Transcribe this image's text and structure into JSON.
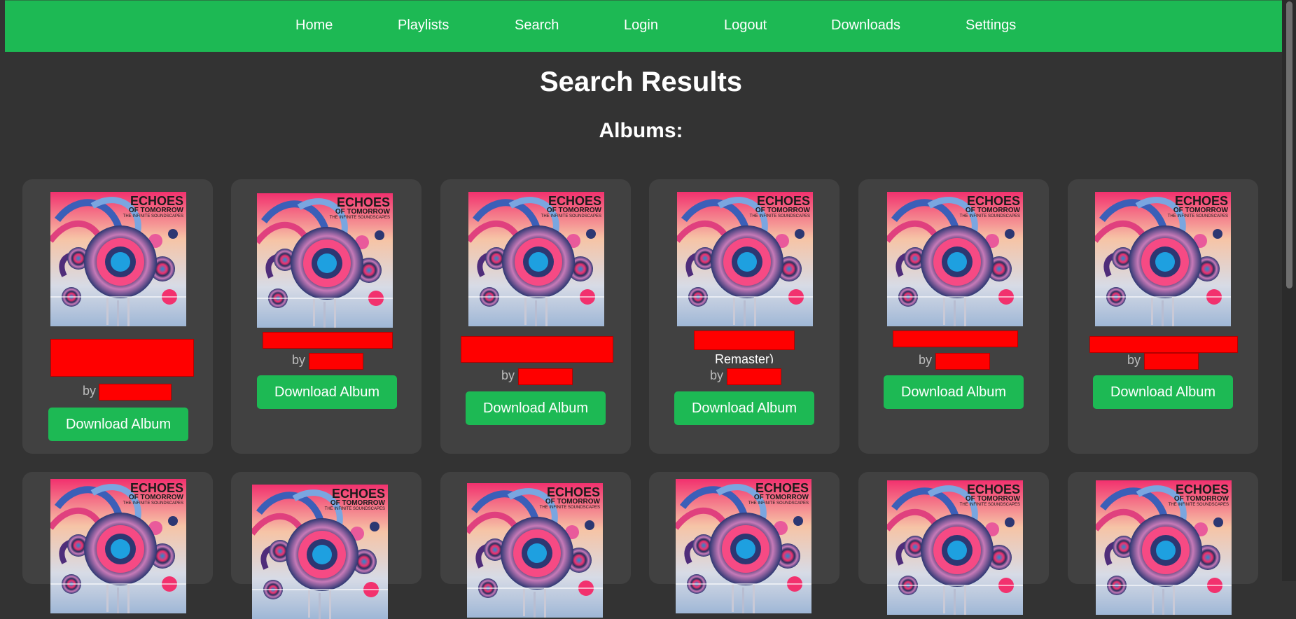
{
  "nav": {
    "home": "Home",
    "playlists": "Playlists",
    "search": "Search",
    "login": "Login",
    "logout": "Logout",
    "downloads": "Downloads",
    "settings": "Settings"
  },
  "page": {
    "title": "Search Results",
    "section": "Albums:"
  },
  "cover": {
    "title_line1": "ECHOES",
    "title_line2": "OF TOMORROW",
    "subtitle": "THE INFINITE SOUNDSCAPES"
  },
  "albums": [
    {
      "by": "by",
      "button": "Download Album"
    },
    {
      "by": "by",
      "button": "Download Album"
    },
    {
      "by": "by",
      "button": "Download Album"
    },
    {
      "title_tail": "Remaster)",
      "by": "by",
      "button": "Download Album"
    },
    {
      "by": "by",
      "button": "Download Album"
    },
    {
      "by": "by",
      "button": "Download Album"
    }
  ],
  "colors": {
    "accent": "#1db954",
    "background": "#333333",
    "card": "#414141",
    "redaction": "#ff0000"
  }
}
